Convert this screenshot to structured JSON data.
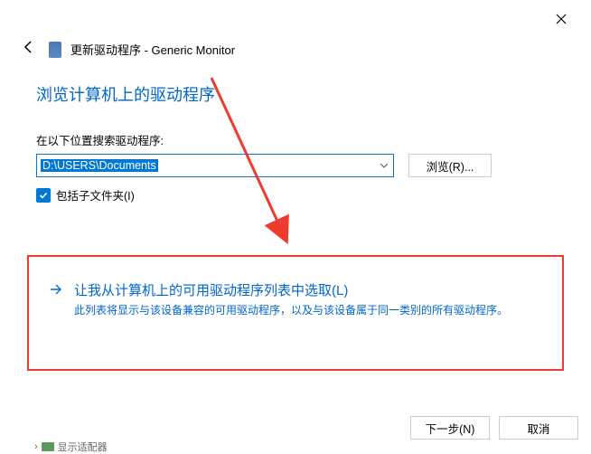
{
  "window": {
    "title": "更新驱动程序 - Generic Monitor"
  },
  "main": {
    "heading": "浏览计算机上的驱动程序",
    "search_label": "在以下位置搜索驱动程序:",
    "path_value": "D:\\USERS\\Documents",
    "browse_btn": "浏览(R)...",
    "include_subfolders": "包括子文件夹(I)"
  },
  "option": {
    "title": "让我从计算机上的可用驱动程序列表中选取(L)",
    "description": "此列表将显示与该设备兼容的可用驱动程序，以及与该设备属于同一类别的所有驱动程序。"
  },
  "footer": {
    "next": "下一步(N)",
    "cancel": "取消"
  },
  "peek": {
    "text": "显示适配器"
  }
}
